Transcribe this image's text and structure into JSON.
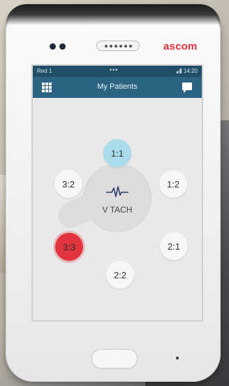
{
  "device": {
    "brand": "ascom",
    "brand_color": "#e3323f"
  },
  "status_bar": {
    "carrier": "Red 1",
    "dots": "•••",
    "time": "14:20"
  },
  "header": {
    "title": "My Patients",
    "left_icon": "grid-icon",
    "right_icon": "message-icon",
    "color": "#2a6482"
  },
  "alarm": {
    "icon": "ecg-waveform-icon",
    "label": "V TACH"
  },
  "beds": [
    {
      "id": "1:1",
      "state": "selected",
      "color": "#a8dcea"
    },
    {
      "id": "1:2",
      "state": "normal"
    },
    {
      "id": "2:1",
      "state": "normal"
    },
    {
      "id": "2:2",
      "state": "normal"
    },
    {
      "id": "3:3",
      "state": "alarm",
      "color": "#e1343f"
    },
    {
      "id": "3:2",
      "state": "normal"
    }
  ]
}
